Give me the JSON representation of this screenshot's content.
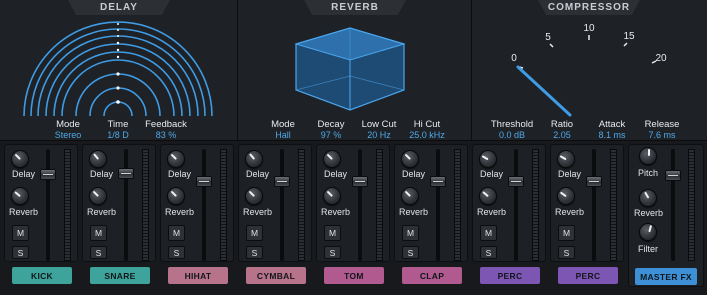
{
  "delay": {
    "title": "DELAY",
    "params": [
      {
        "label": "Mode",
        "value": "Stereo"
      },
      {
        "label": "Time",
        "value": "1/8 D"
      },
      {
        "label": "Feedback",
        "value": "83 %"
      }
    ]
  },
  "reverb": {
    "title": "REVERB",
    "params": [
      {
        "label": "Mode",
        "value": "Hall"
      },
      {
        "label": "Decay",
        "value": "97 %"
      },
      {
        "label": "Low Cut",
        "value": "20 Hz"
      },
      {
        "label": "Hi Cut",
        "value": "25.0 kHz"
      }
    ]
  },
  "compressor": {
    "title": "COMPRESSOR",
    "ratio_scale": [
      "0",
      "5",
      "10",
      "15",
      "20"
    ],
    "params": [
      {
        "label": "Threshold",
        "value": "0.0 dB"
      },
      {
        "label": "Ratio",
        "value": "2.05"
      },
      {
        "label": "Attack",
        "value": "8.1 ms"
      },
      {
        "label": "Release",
        "value": "7.6 ms"
      }
    ]
  },
  "strip_labels": {
    "delay": "Delay",
    "reverb": "Reverb",
    "mute": "M",
    "solo": "S"
  },
  "channels": [
    {
      "name": "KICK",
      "color": "#3ea39a"
    },
    {
      "name": "SNARE",
      "color": "#3ea39a"
    },
    {
      "name": "HIHAT",
      "color": "#b7738a"
    },
    {
      "name": "CYMBAL",
      "color": "#b7738a"
    },
    {
      "name": "TOM",
      "color": "#b05a8f"
    },
    {
      "name": "CLAP",
      "color": "#b05a8f"
    },
    {
      "name": "PERC",
      "color": "#7d55b3"
    },
    {
      "name": "PERC",
      "color": "#7d55b3"
    }
  ],
  "master": {
    "name": "MASTER FX",
    "color": "#3d8fd6",
    "knob_labels": [
      "Pitch",
      "Reverb",
      "Filter"
    ]
  },
  "colors": {
    "accent": "#4fa9e8",
    "panel": "#1e2126",
    "background": "#16181b"
  }
}
